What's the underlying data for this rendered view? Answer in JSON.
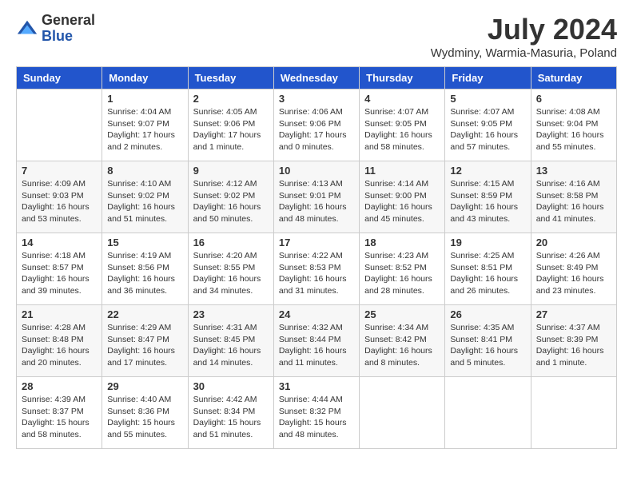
{
  "logo": {
    "general": "General",
    "blue": "Blue"
  },
  "title": "July 2024",
  "location": "Wydminy, Warmia-Masuria, Poland",
  "headers": [
    "Sunday",
    "Monday",
    "Tuesday",
    "Wednesday",
    "Thursday",
    "Friday",
    "Saturday"
  ],
  "weeks": [
    [
      {
        "day": "",
        "info": ""
      },
      {
        "day": "1",
        "info": "Sunrise: 4:04 AM\nSunset: 9:07 PM\nDaylight: 17 hours\nand 2 minutes."
      },
      {
        "day": "2",
        "info": "Sunrise: 4:05 AM\nSunset: 9:06 PM\nDaylight: 17 hours\nand 1 minute."
      },
      {
        "day": "3",
        "info": "Sunrise: 4:06 AM\nSunset: 9:06 PM\nDaylight: 17 hours\nand 0 minutes."
      },
      {
        "day": "4",
        "info": "Sunrise: 4:07 AM\nSunset: 9:05 PM\nDaylight: 16 hours\nand 58 minutes."
      },
      {
        "day": "5",
        "info": "Sunrise: 4:07 AM\nSunset: 9:05 PM\nDaylight: 16 hours\nand 57 minutes."
      },
      {
        "day": "6",
        "info": "Sunrise: 4:08 AM\nSunset: 9:04 PM\nDaylight: 16 hours\nand 55 minutes."
      }
    ],
    [
      {
        "day": "7",
        "info": "Sunrise: 4:09 AM\nSunset: 9:03 PM\nDaylight: 16 hours\nand 53 minutes."
      },
      {
        "day": "8",
        "info": "Sunrise: 4:10 AM\nSunset: 9:02 PM\nDaylight: 16 hours\nand 51 minutes."
      },
      {
        "day": "9",
        "info": "Sunrise: 4:12 AM\nSunset: 9:02 PM\nDaylight: 16 hours\nand 50 minutes."
      },
      {
        "day": "10",
        "info": "Sunrise: 4:13 AM\nSunset: 9:01 PM\nDaylight: 16 hours\nand 48 minutes."
      },
      {
        "day": "11",
        "info": "Sunrise: 4:14 AM\nSunset: 9:00 PM\nDaylight: 16 hours\nand 45 minutes."
      },
      {
        "day": "12",
        "info": "Sunrise: 4:15 AM\nSunset: 8:59 PM\nDaylight: 16 hours\nand 43 minutes."
      },
      {
        "day": "13",
        "info": "Sunrise: 4:16 AM\nSunset: 8:58 PM\nDaylight: 16 hours\nand 41 minutes."
      }
    ],
    [
      {
        "day": "14",
        "info": "Sunrise: 4:18 AM\nSunset: 8:57 PM\nDaylight: 16 hours\nand 39 minutes."
      },
      {
        "day": "15",
        "info": "Sunrise: 4:19 AM\nSunset: 8:56 PM\nDaylight: 16 hours\nand 36 minutes."
      },
      {
        "day": "16",
        "info": "Sunrise: 4:20 AM\nSunset: 8:55 PM\nDaylight: 16 hours\nand 34 minutes."
      },
      {
        "day": "17",
        "info": "Sunrise: 4:22 AM\nSunset: 8:53 PM\nDaylight: 16 hours\nand 31 minutes."
      },
      {
        "day": "18",
        "info": "Sunrise: 4:23 AM\nSunset: 8:52 PM\nDaylight: 16 hours\nand 28 minutes."
      },
      {
        "day": "19",
        "info": "Sunrise: 4:25 AM\nSunset: 8:51 PM\nDaylight: 16 hours\nand 26 minutes."
      },
      {
        "day": "20",
        "info": "Sunrise: 4:26 AM\nSunset: 8:49 PM\nDaylight: 16 hours\nand 23 minutes."
      }
    ],
    [
      {
        "day": "21",
        "info": "Sunrise: 4:28 AM\nSunset: 8:48 PM\nDaylight: 16 hours\nand 20 minutes."
      },
      {
        "day": "22",
        "info": "Sunrise: 4:29 AM\nSunset: 8:47 PM\nDaylight: 16 hours\nand 17 minutes."
      },
      {
        "day": "23",
        "info": "Sunrise: 4:31 AM\nSunset: 8:45 PM\nDaylight: 16 hours\nand 14 minutes."
      },
      {
        "day": "24",
        "info": "Sunrise: 4:32 AM\nSunset: 8:44 PM\nDaylight: 16 hours\nand 11 minutes."
      },
      {
        "day": "25",
        "info": "Sunrise: 4:34 AM\nSunset: 8:42 PM\nDaylight: 16 hours\nand 8 minutes."
      },
      {
        "day": "26",
        "info": "Sunrise: 4:35 AM\nSunset: 8:41 PM\nDaylight: 16 hours\nand 5 minutes."
      },
      {
        "day": "27",
        "info": "Sunrise: 4:37 AM\nSunset: 8:39 PM\nDaylight: 16 hours\nand 1 minute."
      }
    ],
    [
      {
        "day": "28",
        "info": "Sunrise: 4:39 AM\nSunset: 8:37 PM\nDaylight: 15 hours\nand 58 minutes."
      },
      {
        "day": "29",
        "info": "Sunrise: 4:40 AM\nSunset: 8:36 PM\nDaylight: 15 hours\nand 55 minutes."
      },
      {
        "day": "30",
        "info": "Sunrise: 4:42 AM\nSunset: 8:34 PM\nDaylight: 15 hours\nand 51 minutes."
      },
      {
        "day": "31",
        "info": "Sunrise: 4:44 AM\nSunset: 8:32 PM\nDaylight: 15 hours\nand 48 minutes."
      },
      {
        "day": "",
        "info": ""
      },
      {
        "day": "",
        "info": ""
      },
      {
        "day": "",
        "info": ""
      }
    ]
  ]
}
